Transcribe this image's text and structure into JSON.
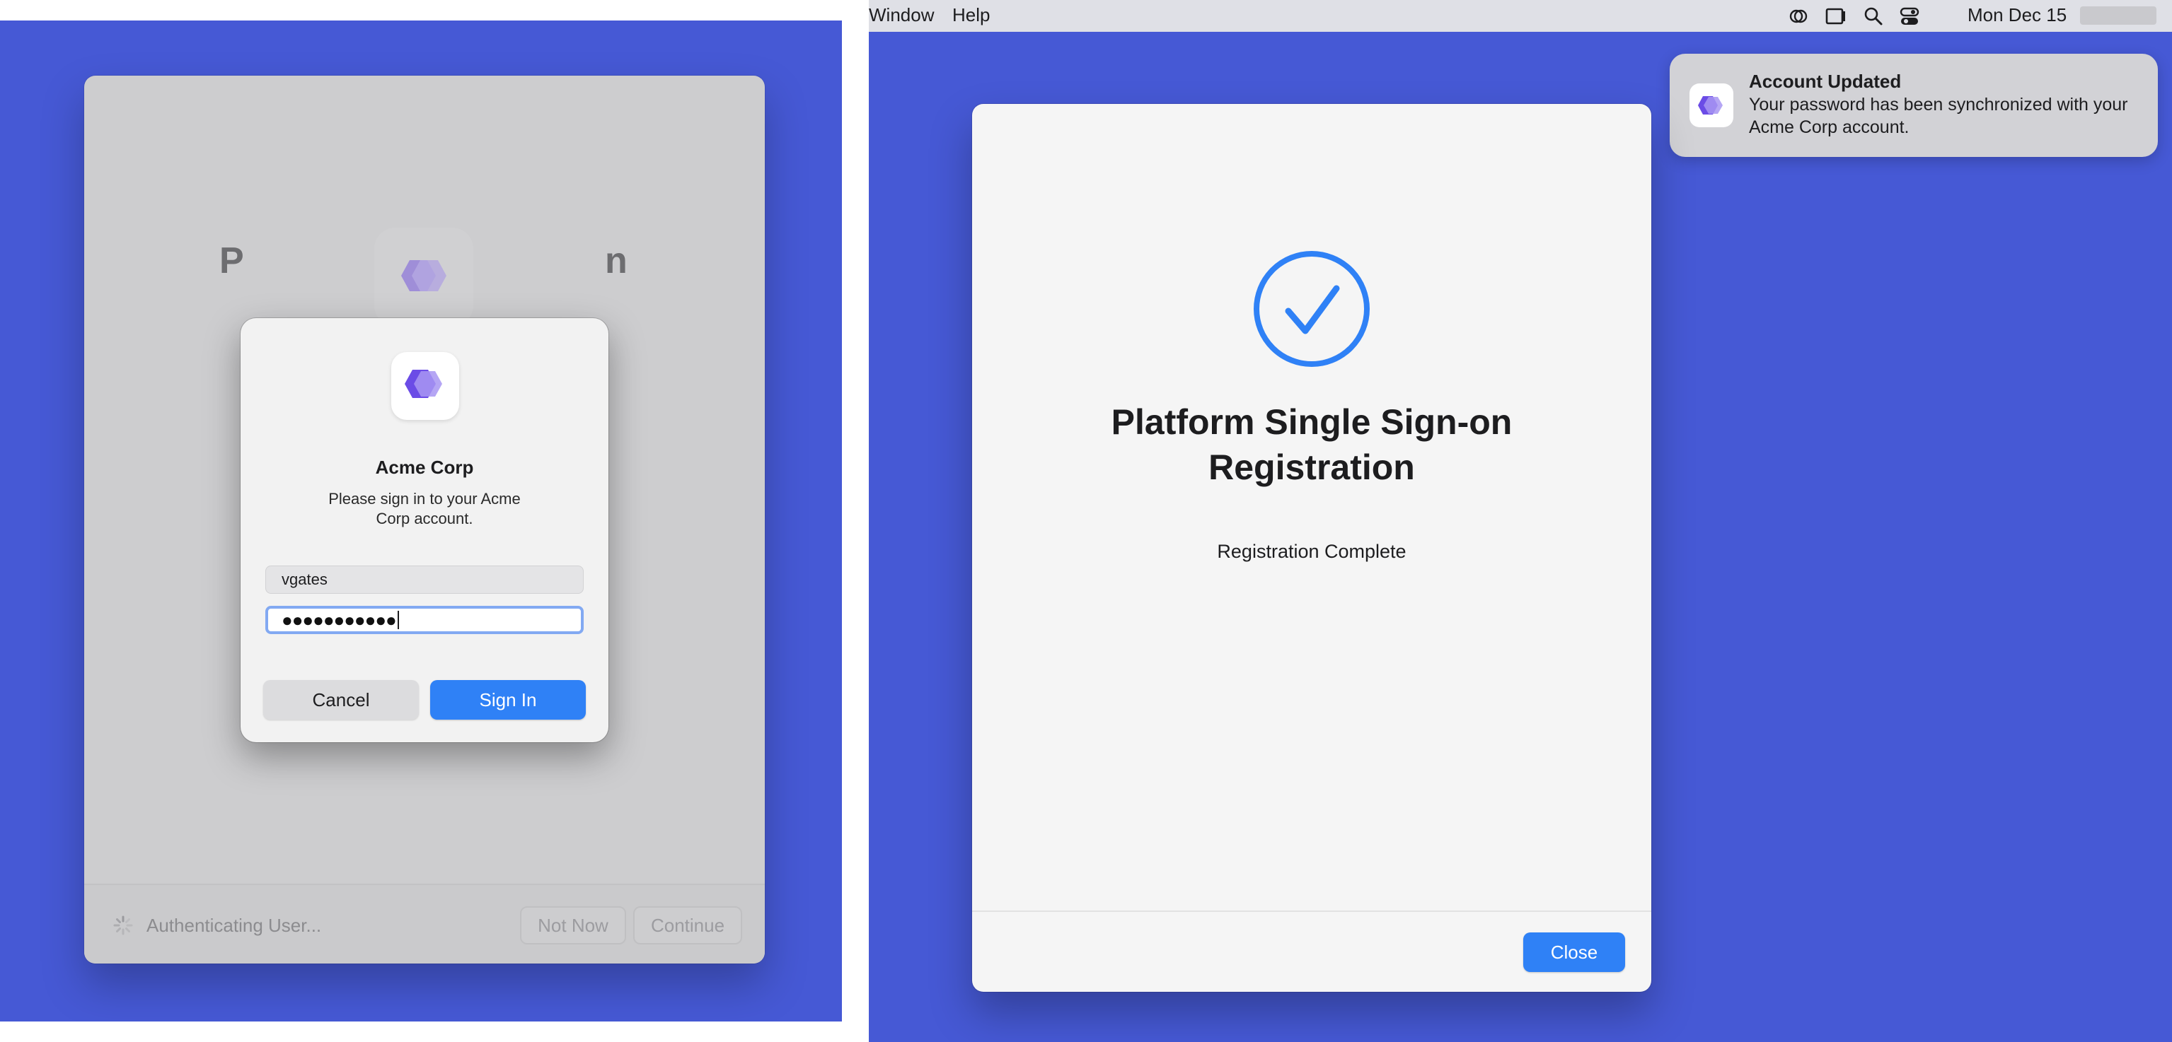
{
  "left": {
    "background_window": {
      "title_left_fragment": "P",
      "title_right_fragment": "n",
      "status_text": "Authenticating User...",
      "not_now_label": "Not Now",
      "continue_label": "Continue"
    },
    "signin_dialog": {
      "title": "Acme Corp",
      "message": "Please sign in to your Acme Corp account.",
      "username_value": "vgates",
      "password_value": "●●●●●●●●●●●",
      "cancel_label": "Cancel",
      "signin_label": "Sign In"
    }
  },
  "right": {
    "menubar": {
      "items": [
        "Window",
        "Help"
      ],
      "icons": [
        "screen-mirroring-icon",
        "screen-record-icon",
        "search-icon",
        "control-center-icon"
      ],
      "date": "Mon Dec 15"
    },
    "notification": {
      "title": "Account Updated",
      "body": "Your password has been synchronized with your Acme Corp account."
    },
    "registration_window": {
      "title": "Platform Single Sign-on Registration",
      "status": "Registration Complete",
      "close_label": "Close"
    }
  },
  "colors": {
    "desktop": "#4659d5",
    "accent_blue": "#2f81f6",
    "logo_purple": "#6b4ce6"
  }
}
